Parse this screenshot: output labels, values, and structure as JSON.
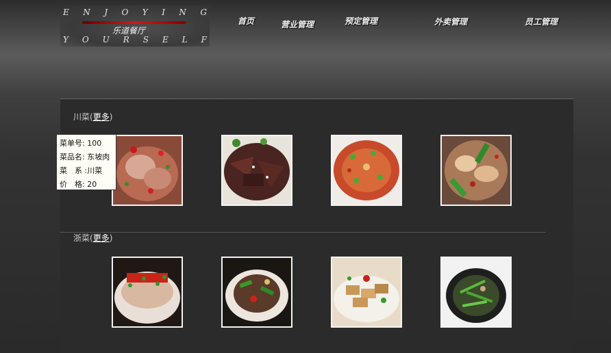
{
  "logo": {
    "top_letters": [
      "E",
      "N",
      "J",
      "O",
      "Y",
      "I",
      "N",
      "G"
    ],
    "bottom_letters": [
      "Y",
      "O",
      "U",
      "R",
      "S",
      "E",
      "L",
      "F"
    ],
    "name": "乐道餐厅"
  },
  "nav": {
    "items": [
      {
        "label": "首页"
      },
      {
        "label": "营业管理"
      },
      {
        "label": "预定管理"
      },
      {
        "label": "外卖管理"
      },
      {
        "label": "员工管理"
      }
    ]
  },
  "sections": [
    {
      "title": "川菜",
      "more": "更多"
    },
    {
      "title": "浙菜",
      "more": "更多"
    }
  ],
  "tooltip": {
    "id_line": "菜单号: 100",
    "name_line": "菜品名: 东坡肉",
    "cuisine_line": "菜　系 :川菜",
    "price_line": "价　格: 20"
  },
  "colors": {
    "accent_red": "#d21818",
    "frame": "#f4f4f4",
    "background": "#2b2b2b"
  }
}
